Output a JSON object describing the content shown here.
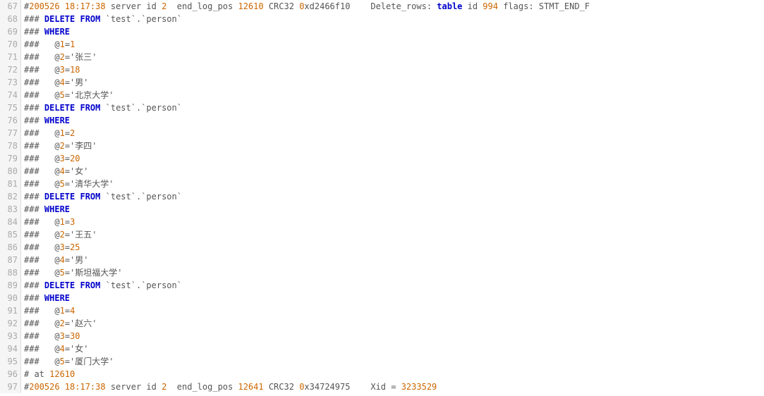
{
  "startLine": 67,
  "lines": [
    {
      "tokens": [
        {
          "c": "hash",
          "t": "#"
        },
        {
          "c": "num",
          "t": "200526 18:17:38"
        },
        {
          "c": "gray",
          "t": " server id "
        },
        {
          "c": "num",
          "t": "2"
        },
        {
          "c": "gray",
          "t": "  end_log_pos "
        },
        {
          "c": "num",
          "t": "12610"
        },
        {
          "c": "gray",
          "t": " CRC32 "
        },
        {
          "c": "num",
          "t": "0"
        },
        {
          "c": "gray",
          "t": "xd2466f10    Delete_rows: "
        },
        {
          "c": "kw",
          "t": "table"
        },
        {
          "c": "gray",
          "t": " id "
        },
        {
          "c": "num",
          "t": "994"
        },
        {
          "c": "gray",
          "t": " flags: STMT_END_F"
        }
      ]
    },
    {
      "tokens": [
        {
          "c": "hash",
          "t": "### "
        },
        {
          "c": "kw",
          "t": "DELETE FROM"
        },
        {
          "c": "gray",
          "t": " `test`.`person`"
        }
      ]
    },
    {
      "tokens": [
        {
          "c": "hash",
          "t": "### "
        },
        {
          "c": "kw",
          "t": "WHERE"
        }
      ]
    },
    {
      "tokens": [
        {
          "c": "hash",
          "t": "###   "
        },
        {
          "c": "gray",
          "t": "@"
        },
        {
          "c": "num",
          "t": "1"
        },
        {
          "c": "gray",
          "t": "="
        },
        {
          "c": "num",
          "t": "1"
        }
      ]
    },
    {
      "tokens": [
        {
          "c": "hash",
          "t": "###   "
        },
        {
          "c": "gray",
          "t": "@"
        },
        {
          "c": "num",
          "t": "2"
        },
        {
          "c": "gray",
          "t": "='张三'"
        }
      ]
    },
    {
      "tokens": [
        {
          "c": "hash",
          "t": "###   "
        },
        {
          "c": "gray",
          "t": "@"
        },
        {
          "c": "num",
          "t": "3"
        },
        {
          "c": "gray",
          "t": "="
        },
        {
          "c": "num",
          "t": "18"
        }
      ]
    },
    {
      "tokens": [
        {
          "c": "hash",
          "t": "###   "
        },
        {
          "c": "gray",
          "t": "@"
        },
        {
          "c": "num",
          "t": "4"
        },
        {
          "c": "gray",
          "t": "='男'"
        }
      ]
    },
    {
      "tokens": [
        {
          "c": "hash",
          "t": "###   "
        },
        {
          "c": "gray",
          "t": "@"
        },
        {
          "c": "num",
          "t": "5"
        },
        {
          "c": "gray",
          "t": "='北京大学'"
        }
      ]
    },
    {
      "tokens": [
        {
          "c": "hash",
          "t": "### "
        },
        {
          "c": "kw",
          "t": "DELETE FROM"
        },
        {
          "c": "gray",
          "t": " `test`.`person`"
        }
      ]
    },
    {
      "tokens": [
        {
          "c": "hash",
          "t": "### "
        },
        {
          "c": "kw",
          "t": "WHERE"
        }
      ]
    },
    {
      "tokens": [
        {
          "c": "hash",
          "t": "###   "
        },
        {
          "c": "gray",
          "t": "@"
        },
        {
          "c": "num",
          "t": "1"
        },
        {
          "c": "gray",
          "t": "="
        },
        {
          "c": "num",
          "t": "2"
        }
      ]
    },
    {
      "tokens": [
        {
          "c": "hash",
          "t": "###   "
        },
        {
          "c": "gray",
          "t": "@"
        },
        {
          "c": "num",
          "t": "2"
        },
        {
          "c": "gray",
          "t": "='李四'"
        }
      ]
    },
    {
      "tokens": [
        {
          "c": "hash",
          "t": "###   "
        },
        {
          "c": "gray",
          "t": "@"
        },
        {
          "c": "num",
          "t": "3"
        },
        {
          "c": "gray",
          "t": "="
        },
        {
          "c": "num",
          "t": "20"
        }
      ]
    },
    {
      "tokens": [
        {
          "c": "hash",
          "t": "###   "
        },
        {
          "c": "gray",
          "t": "@"
        },
        {
          "c": "num",
          "t": "4"
        },
        {
          "c": "gray",
          "t": "='女'"
        }
      ]
    },
    {
      "tokens": [
        {
          "c": "hash",
          "t": "###   "
        },
        {
          "c": "gray",
          "t": "@"
        },
        {
          "c": "num",
          "t": "5"
        },
        {
          "c": "gray",
          "t": "='清华大学'"
        }
      ]
    },
    {
      "tokens": [
        {
          "c": "hash",
          "t": "### "
        },
        {
          "c": "kw",
          "t": "DELETE FROM"
        },
        {
          "c": "gray",
          "t": " `test`.`person`"
        }
      ]
    },
    {
      "tokens": [
        {
          "c": "hash",
          "t": "### "
        },
        {
          "c": "kw",
          "t": "WHERE"
        }
      ]
    },
    {
      "tokens": [
        {
          "c": "hash",
          "t": "###   "
        },
        {
          "c": "gray",
          "t": "@"
        },
        {
          "c": "num",
          "t": "1"
        },
        {
          "c": "gray",
          "t": "="
        },
        {
          "c": "num",
          "t": "3"
        }
      ]
    },
    {
      "tokens": [
        {
          "c": "hash",
          "t": "###   "
        },
        {
          "c": "gray",
          "t": "@"
        },
        {
          "c": "num",
          "t": "2"
        },
        {
          "c": "gray",
          "t": "='王五'"
        }
      ]
    },
    {
      "tokens": [
        {
          "c": "hash",
          "t": "###   "
        },
        {
          "c": "gray",
          "t": "@"
        },
        {
          "c": "num",
          "t": "3"
        },
        {
          "c": "gray",
          "t": "="
        },
        {
          "c": "num",
          "t": "25"
        }
      ]
    },
    {
      "tokens": [
        {
          "c": "hash",
          "t": "###   "
        },
        {
          "c": "gray",
          "t": "@"
        },
        {
          "c": "num",
          "t": "4"
        },
        {
          "c": "gray",
          "t": "='男'"
        }
      ]
    },
    {
      "tokens": [
        {
          "c": "hash",
          "t": "###   "
        },
        {
          "c": "gray",
          "t": "@"
        },
        {
          "c": "num",
          "t": "5"
        },
        {
          "c": "gray",
          "t": "='斯坦福大学'"
        }
      ]
    },
    {
      "tokens": [
        {
          "c": "hash",
          "t": "### "
        },
        {
          "c": "kw",
          "t": "DELETE FROM"
        },
        {
          "c": "gray",
          "t": " `test`.`person`"
        }
      ]
    },
    {
      "tokens": [
        {
          "c": "hash",
          "t": "### "
        },
        {
          "c": "kw",
          "t": "WHERE"
        }
      ]
    },
    {
      "tokens": [
        {
          "c": "hash",
          "t": "###   "
        },
        {
          "c": "gray",
          "t": "@"
        },
        {
          "c": "num",
          "t": "1"
        },
        {
          "c": "gray",
          "t": "="
        },
        {
          "c": "num",
          "t": "4"
        }
      ]
    },
    {
      "tokens": [
        {
          "c": "hash",
          "t": "###   "
        },
        {
          "c": "gray",
          "t": "@"
        },
        {
          "c": "num",
          "t": "2"
        },
        {
          "c": "gray",
          "t": "='赵六'"
        }
      ]
    },
    {
      "tokens": [
        {
          "c": "hash",
          "t": "###   "
        },
        {
          "c": "gray",
          "t": "@"
        },
        {
          "c": "num",
          "t": "3"
        },
        {
          "c": "gray",
          "t": "="
        },
        {
          "c": "num",
          "t": "30"
        }
      ]
    },
    {
      "tokens": [
        {
          "c": "hash",
          "t": "###   "
        },
        {
          "c": "gray",
          "t": "@"
        },
        {
          "c": "num",
          "t": "4"
        },
        {
          "c": "gray",
          "t": "='女'"
        }
      ]
    },
    {
      "tokens": [
        {
          "c": "hash",
          "t": "###   "
        },
        {
          "c": "gray",
          "t": "@"
        },
        {
          "c": "num",
          "t": "5"
        },
        {
          "c": "gray",
          "t": "='厦门大学'"
        }
      ]
    },
    {
      "tokens": [
        {
          "c": "hash",
          "t": "# at "
        },
        {
          "c": "num",
          "t": "12610"
        }
      ]
    },
    {
      "tokens": [
        {
          "c": "hash",
          "t": "#"
        },
        {
          "c": "num",
          "t": "200526 18:17:38"
        },
        {
          "c": "gray",
          "t": " server id "
        },
        {
          "c": "num",
          "t": "2"
        },
        {
          "c": "gray",
          "t": "  end_log_pos "
        },
        {
          "c": "num",
          "t": "12641"
        },
        {
          "c": "gray",
          "t": " CRC32 "
        },
        {
          "c": "num",
          "t": "0"
        },
        {
          "c": "gray",
          "t": "x34724975    Xid = "
        },
        {
          "c": "num",
          "t": "3233529"
        }
      ]
    }
  ]
}
